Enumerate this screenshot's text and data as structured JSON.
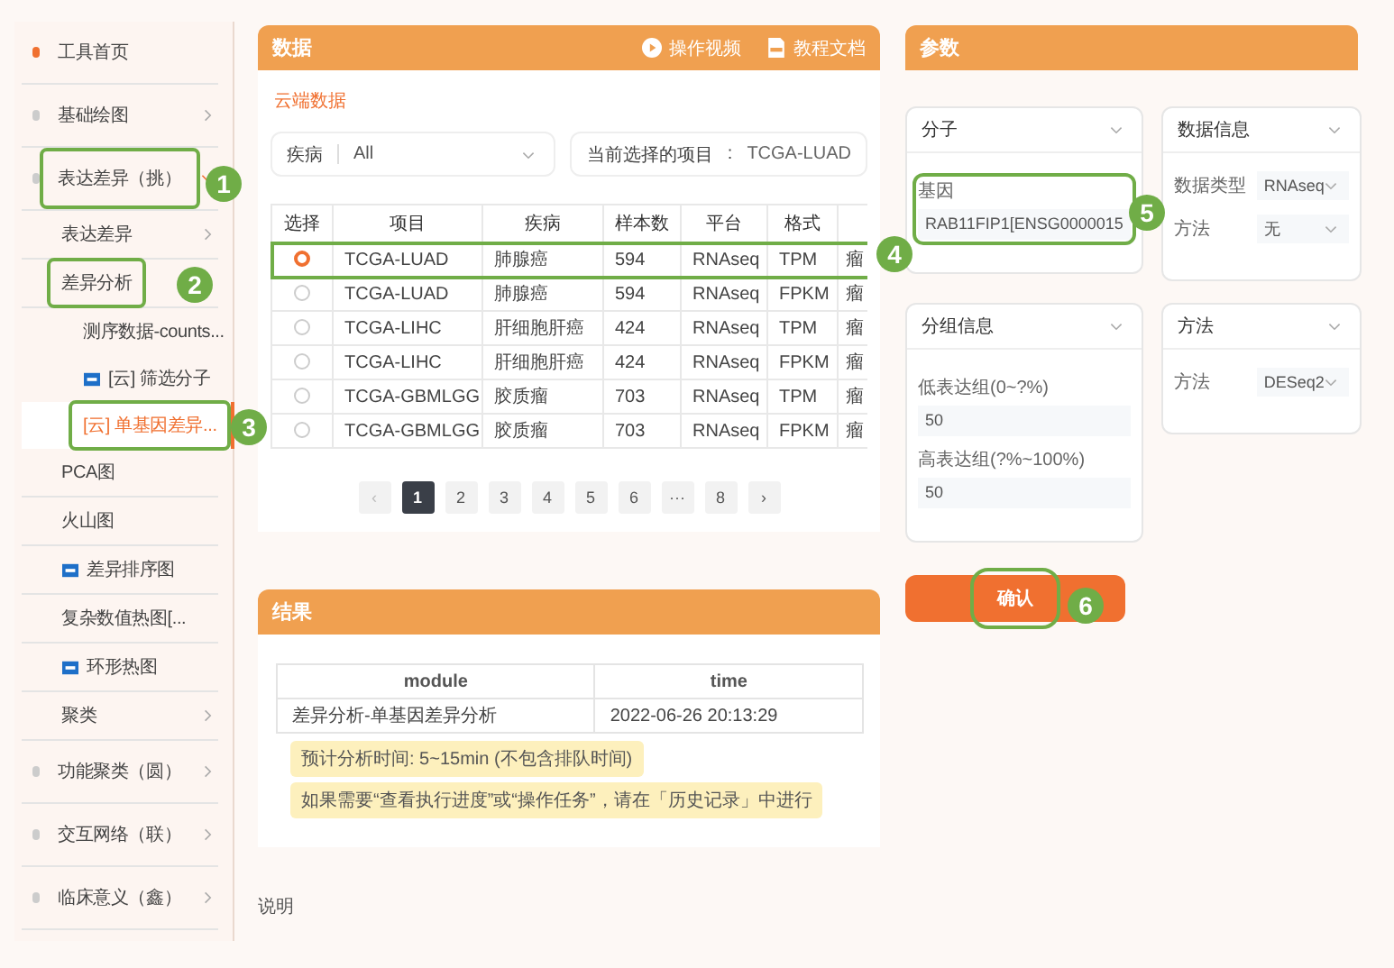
{
  "sidebar": {
    "items": [
      {
        "label": "工具首页",
        "dot_active": true,
        "selected": false,
        "highlighted": false
      },
      {
        "label": "基础绘图",
        "dot_active": false,
        "selected": false,
        "highlighted": false,
        "expanded": false
      },
      {
        "label": "表达差异（挑）",
        "dot_active": false,
        "selected": false,
        "highlighted": true,
        "expanded": true,
        "children": [
          {
            "label": "表达差异",
            "selected": false,
            "highlighted": false,
            "expanded": false
          },
          {
            "label": "差异分析",
            "selected": false,
            "highlighted": true,
            "children": [
              {
                "label": "测序数据-counts...",
                "selected": false,
                "highlighted": false,
                "is_new": false
              },
              {
                "label": "[云] 筛选分子",
                "selected": false,
                "highlighted": false,
                "is_new": true
              },
              {
                "label": "[云] 单基因差异...",
                "selected": true,
                "highlighted": true,
                "is_new": false
              }
            ]
          },
          {
            "label": "PCA图",
            "selected": false,
            "highlighted": false,
            "is_new": false
          },
          {
            "label": "火山图",
            "selected": false,
            "highlighted": false,
            "is_new": false
          },
          {
            "label": "差异排序图",
            "selected": false,
            "highlighted": false,
            "is_new": true
          },
          {
            "label": "复杂数值热图[...",
            "selected": false,
            "highlighted": false,
            "is_new": false
          },
          {
            "label": "环形热图",
            "selected": false,
            "highlighted": false,
            "is_new": true
          },
          {
            "label": "聚类",
            "selected": false,
            "highlighted": false,
            "expanded": false
          }
        ]
      },
      {
        "label": "功能聚类（圆）",
        "dot_active": false,
        "selected": false,
        "highlighted": false,
        "expanded": false
      },
      {
        "label": "交互网络（联）",
        "dot_active": false,
        "selected": false,
        "highlighted": false,
        "expanded": false
      },
      {
        "label": "临床意义（鑫）",
        "dot_active": false,
        "selected": false,
        "highlighted": false,
        "expanded": false
      }
    ]
  },
  "data_panel": {
    "title": "数据",
    "actions": [
      "操作视频",
      "教程文档"
    ],
    "source_label": "云端数据",
    "disease_filter": {
      "label": "疾病",
      "value": "All"
    },
    "current_project": {
      "label": "当前选择的项目",
      "separator": ":",
      "value": "TCGA-LUAD"
    },
    "table": {
      "columns": [
        "选择",
        "项目",
        "疾病",
        "样本数",
        "平台",
        "格式",
        ""
      ],
      "rows": [
        {
          "selected": true,
          "highlighted": true,
          "cells": [
            "",
            "TCGA-LUAD",
            "肺腺癌",
            "594",
            "RNAseq",
            "TPM",
            "瘤"
          ]
        },
        {
          "selected": false,
          "highlighted": false,
          "cells": [
            "",
            "TCGA-LUAD",
            "肺腺癌",
            "594",
            "RNAseq",
            "FPKM",
            "瘤"
          ]
        },
        {
          "selected": false,
          "highlighted": false,
          "cells": [
            "",
            "TCGA-LIHC",
            "肝细胞肝癌",
            "424",
            "RNAseq",
            "TPM",
            "瘤"
          ]
        },
        {
          "selected": false,
          "highlighted": false,
          "cells": [
            "",
            "TCGA-LIHC",
            "肝细胞肝癌",
            "424",
            "RNAseq",
            "FPKM",
            "瘤"
          ]
        },
        {
          "selected": false,
          "highlighted": false,
          "cells": [
            "",
            "TCGA-GBMLGG",
            "胶质瘤",
            "703",
            "RNAseq",
            "TPM",
            "瘤"
          ]
        },
        {
          "selected": false,
          "highlighted": false,
          "cells": [
            "",
            "TCGA-GBMLGG",
            "胶质瘤",
            "703",
            "RNAseq",
            "FPKM",
            "瘤"
          ]
        }
      ]
    },
    "pagination": {
      "prev": "‹",
      "next": "›",
      "pages": [
        {
          "label": "1",
          "selected": true
        },
        {
          "label": "2",
          "selected": false
        },
        {
          "label": "3",
          "selected": false
        },
        {
          "label": "4",
          "selected": false
        },
        {
          "label": "5",
          "selected": false
        },
        {
          "label": "6",
          "selected": false
        },
        {
          "label": "···",
          "selected": false
        },
        {
          "label": "8",
          "selected": false
        }
      ]
    }
  },
  "params_panel": {
    "title": "参数",
    "cards": [
      {
        "title": "分子",
        "kind": "fields",
        "rows": [
          {
            "label": "基因",
            "value": "RAB11FIP1[ENSG0000015",
            "highlighted": true
          }
        ]
      },
      {
        "title": "数据信息",
        "kind": "selects",
        "rows": [
          {
            "label": "数据类型",
            "value": "RNAseq"
          },
          {
            "label": "方法",
            "value": "无"
          }
        ]
      },
      {
        "title": "分组信息",
        "kind": "fields",
        "rows": [
          {
            "label": "低表达组(0~?%)",
            "value": "50",
            "highlighted": false
          },
          {
            "label": "高表达组(?%~100%)",
            "value": "50",
            "highlighted": false
          }
        ]
      },
      {
        "title": "方法",
        "kind": "selects",
        "rows": [
          {
            "label": "方法",
            "value": "DESeq2"
          }
        ]
      }
    ],
    "confirm": {
      "label": "确认",
      "highlighted": true
    }
  },
  "result_panel": {
    "title": "结果",
    "table": {
      "columns": [
        "module",
        "time"
      ],
      "rows": [
        [
          "差异分析-单基因差异分析",
          "2022-06-26 20:13:29"
        ]
      ]
    },
    "notices": [
      "预计分析时间: 5~15min (不包含排队时间)",
      "如果需要“查看执行进度”或“操作任务”，请在「历史记录」中进行"
    ]
  },
  "footer": "说明",
  "callouts": [
    {
      "number": "1"
    },
    {
      "number": "2"
    },
    {
      "number": "3"
    },
    {
      "number": "4"
    },
    {
      "number": "5"
    },
    {
      "number": "6"
    }
  ]
}
